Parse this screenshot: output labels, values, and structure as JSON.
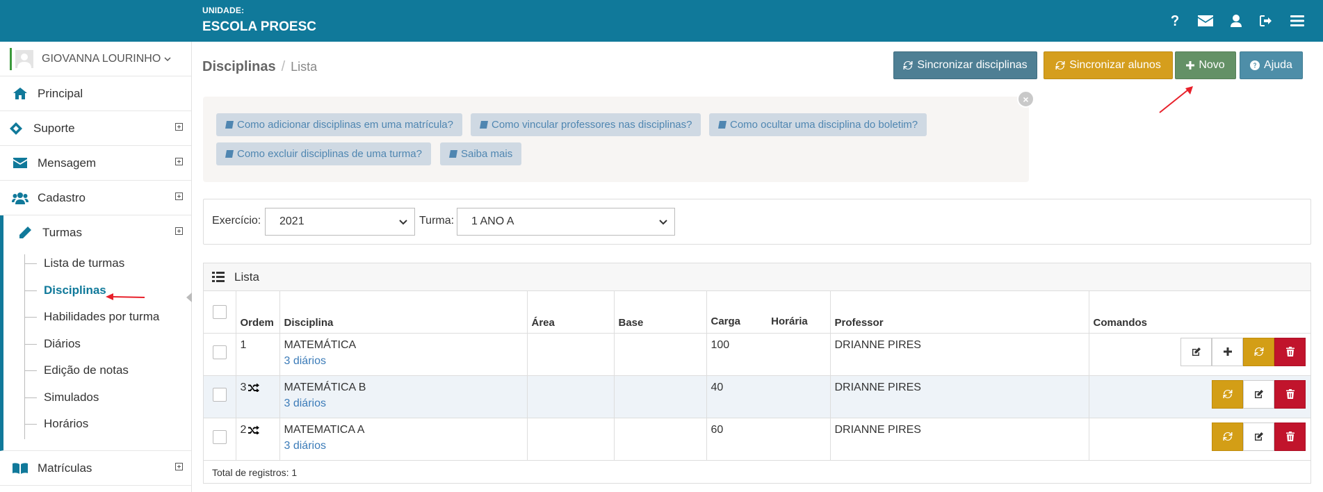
{
  "topbar": {
    "unit_label": "UNIDADE:",
    "unit_name": "ESCOLA PROESC",
    "icons": [
      "question-icon",
      "envelope-icon",
      "user-icon",
      "sign-out-icon",
      "hamburger-menu-icon"
    ]
  },
  "sidebar": {
    "user_name": "GIOVANNA LOURINHO",
    "items": [
      {
        "label": "Principal",
        "icon": "home-icon"
      },
      {
        "label": "Suporte",
        "icon": "ticket-icon"
      },
      {
        "label": "Mensagem",
        "icon": "envelope-icon"
      },
      {
        "label": "Cadastro",
        "icon": "users-icon"
      },
      {
        "label": "Turmas",
        "icon": "pencil-icon"
      },
      {
        "label": "Matrículas",
        "icon": "book-icon"
      }
    ],
    "turmas_sub": [
      "Lista de turmas",
      "Disciplinas",
      "Habilidades por turma",
      "Diários",
      "Edição de notas",
      "Simulados",
      "Horários"
    ],
    "active_sub": "Disciplinas"
  },
  "breadcrumb": {
    "title": "Disciplinas",
    "separator": "/",
    "current": "Lista"
  },
  "toolbar": {
    "sync_disciplinas": "Sincronizar disciplinas",
    "sync_alunos": "Sincronizar alunos",
    "novo": "Novo",
    "ajuda": "Ajuda"
  },
  "help": {
    "close": "×",
    "links": [
      "Como adicionar disciplinas em uma matrícula?",
      "Como vincular professores nas disciplinas?",
      "Como ocultar uma disciplina do boletim?",
      "Como excluir disciplinas de uma turma?",
      "Saiba mais"
    ]
  },
  "filters": {
    "exercicio_label": "Exercício:",
    "exercicio_value": "2021",
    "turma_label": "Turma:",
    "turma_value": "1 ANO A"
  },
  "table": {
    "panel_title": "Lista",
    "columns": [
      "Ordem",
      "Disciplina",
      "Área",
      "Base",
      "Carga Horária",
      "Professor",
      "Comandos"
    ],
    "rows": [
      {
        "ordem": "1",
        "disciplina": "MATEMÁTICA",
        "diarios": "3 diários",
        "area": "",
        "base": "",
        "carga": "100",
        "professor": "DRIANNE PIRES"
      },
      {
        "ordem": "3",
        "disciplina": "MATEMÁTICA B",
        "diarios": "3 diários",
        "area": "",
        "base": "",
        "carga": "40",
        "professor": "DRIANNE PIRES"
      },
      {
        "ordem": "2",
        "disciplina": "MATEMATICA A",
        "diarios": "3 diários",
        "area": "",
        "base": "",
        "carga": "60",
        "professor": "DRIANNE PIRES"
      }
    ],
    "footer": "Total de registros: 1"
  },
  "colors": {
    "primary": "#10799a",
    "gold": "#d39e16",
    "red": "#c1142c",
    "green": "#649166",
    "annotation_red": "#e8202a"
  }
}
